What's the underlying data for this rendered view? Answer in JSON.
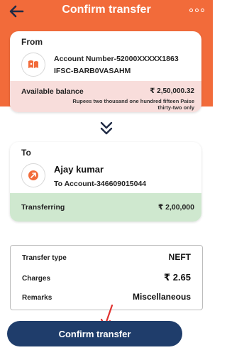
{
  "header": {
    "title": "Confirm transfer"
  },
  "from": {
    "label": "From",
    "account_number": "Account Number-52000XXXXX1863",
    "ifsc": "IFSC-BARB0VASAHM",
    "available_balance_label": "Available balance",
    "available_balance_value": "₹ 2,50,000.32",
    "available_balance_words": "Rupees two thousand one hundred fifteen Paise thirty-two only"
  },
  "to": {
    "label": "To",
    "name": "Ajay kumar",
    "account": "To Account-346609015044",
    "transferring_label": "Transferring",
    "transferring_value": "₹ 2,00,000"
  },
  "details": {
    "transfer_type_label": "Transfer type",
    "transfer_type_value": "NEFT",
    "charges_label": "Charges",
    "charges_value": "₹ 2.65",
    "remarks_label": "Remarks",
    "remarks_value": "Miscellaneous"
  },
  "actions": {
    "confirm_label": "Confirm transfer"
  },
  "colors": {
    "header_bg": "#f26b3a",
    "balance_bg": "#f8dddb",
    "transfer_bg": "#cfe8cf",
    "button_bg": "#1f3d6b",
    "arrow": "#e0322f"
  }
}
